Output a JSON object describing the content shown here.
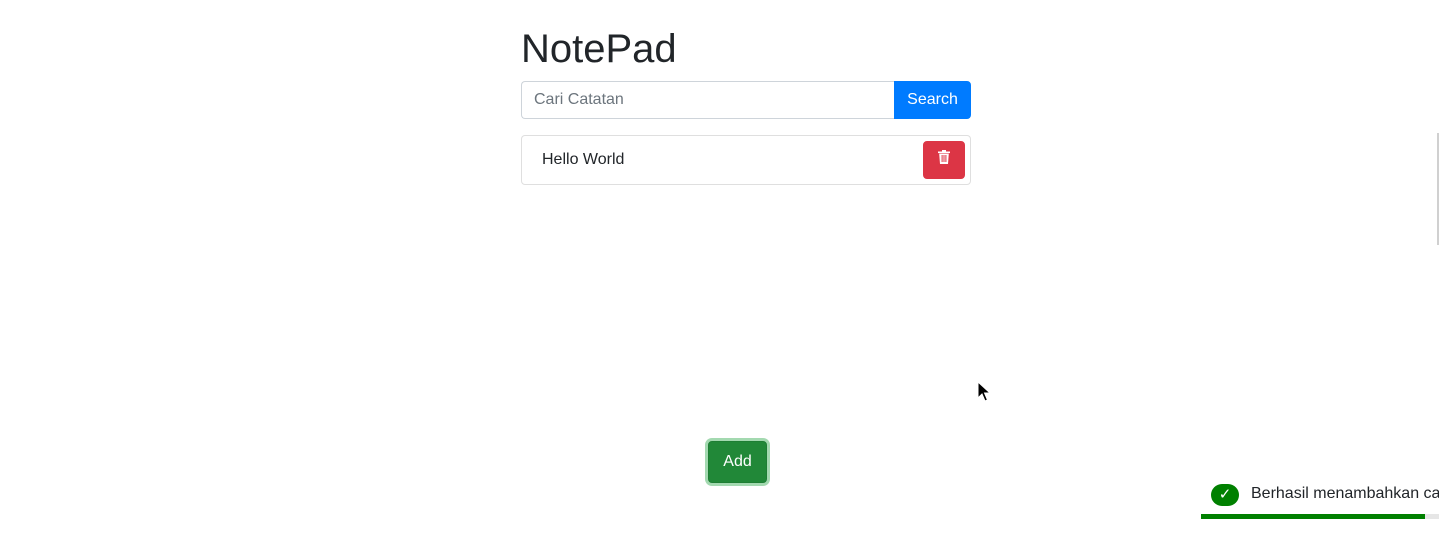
{
  "app": {
    "title": "NotePad"
  },
  "search": {
    "placeholder": "Cari Catatan",
    "value": "",
    "button_label": "Search"
  },
  "notes": [
    {
      "text": "Hello World",
      "delete_icon": "trash-icon"
    }
  ],
  "actions": {
    "add_label": "Add"
  },
  "toast": {
    "icon": "check-icon",
    "icon_glyph": "✓",
    "message": "Berhasil menambahkan catatan",
    "progress_fraction": 0.94
  },
  "colors": {
    "primary": "#007bff",
    "danger": "#dc3545",
    "success": "#218838",
    "toast_accent": "#008000"
  }
}
